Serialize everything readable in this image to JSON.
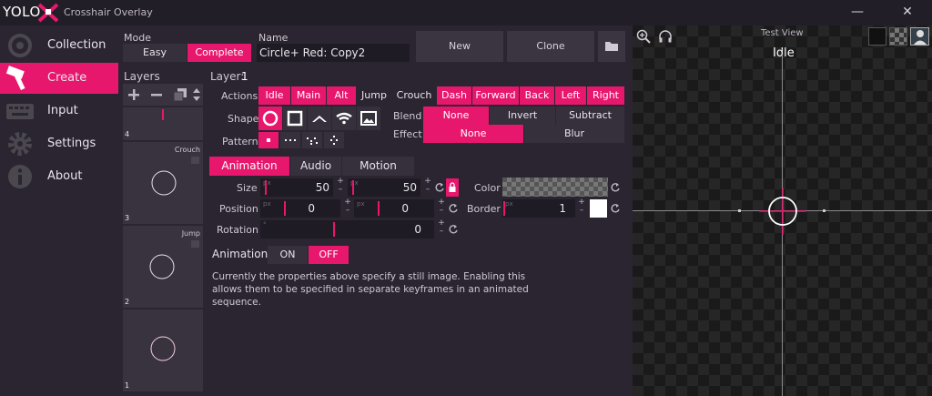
{
  "app": {
    "logo": "YOLO",
    "title": "Crosshair Overlay",
    "minimize": "—",
    "close": "✕"
  },
  "sidebar": {
    "items": [
      {
        "label": "Collection",
        "icon": "target-icon"
      },
      {
        "label": "Create",
        "icon": "hammer-icon"
      },
      {
        "label": "Input",
        "icon": "keyboard-icon"
      },
      {
        "label": "Settings",
        "icon": "gear-icon"
      },
      {
        "label": "About",
        "icon": "info-icon"
      }
    ]
  },
  "mode": {
    "label": "Mode",
    "options": [
      "Easy",
      "Complete"
    ],
    "selected": "Complete"
  },
  "name": {
    "label": "Name",
    "value": "Circle+ Red: Copy2"
  },
  "toolbar": {
    "new_label": "New",
    "clone_label": "Clone"
  },
  "layers": {
    "label": "Layers",
    "cards": [
      {
        "num": "4",
        "tag": ""
      },
      {
        "num": "3",
        "tag": "Crouch"
      },
      {
        "num": "2",
        "tag": "Jump"
      },
      {
        "num": "1",
        "tag": ""
      }
    ]
  },
  "layer": {
    "label": "Layer:",
    "value": "1"
  },
  "actions": {
    "label": "Actions",
    "items": [
      "Idle",
      "Main",
      "Alt",
      "Jump",
      "Crouch",
      "Dash",
      "Forward",
      "Back",
      "Left",
      "Right"
    ],
    "off": [
      "Jump",
      "Crouch"
    ]
  },
  "shape": {
    "label": "Shape"
  },
  "pattern": {
    "label": "Pattern"
  },
  "blend": {
    "label": "Blend",
    "options": [
      "None",
      "Invert",
      "Subtract"
    ],
    "selected": "None"
  },
  "effect": {
    "label": "Effect",
    "options": [
      "None",
      "Blur"
    ],
    "selected": "None"
  },
  "tabs": {
    "items": [
      "Animation",
      "Audio",
      "Motion"
    ],
    "selected": "Animation"
  },
  "props": {
    "size": {
      "label": "Size",
      "unit": "px",
      "w": "50",
      "h": "50"
    },
    "position": {
      "label": "Position",
      "unit": "px",
      "x": "0",
      "y": "0"
    },
    "rotation": {
      "label": "Rotation",
      "unit": "°",
      "value": "0"
    },
    "color": {
      "label": "Color"
    },
    "border": {
      "label": "Border",
      "unit": "px",
      "value": "1"
    },
    "plus": "+",
    "minus": "–"
  },
  "animation": {
    "label": "Animation",
    "on": "ON",
    "off": "OFF",
    "selected": "OFF",
    "description": "Currently the properties above specify a still image. Enabling this allows them to be specified in separate keyframes in an animated sequence."
  },
  "preview": {
    "title": "Test View",
    "state": "Idle"
  },
  "colors": {
    "accent": "#e8176e",
    "panel": "#2a2530",
    "field": "#1f1b24"
  }
}
